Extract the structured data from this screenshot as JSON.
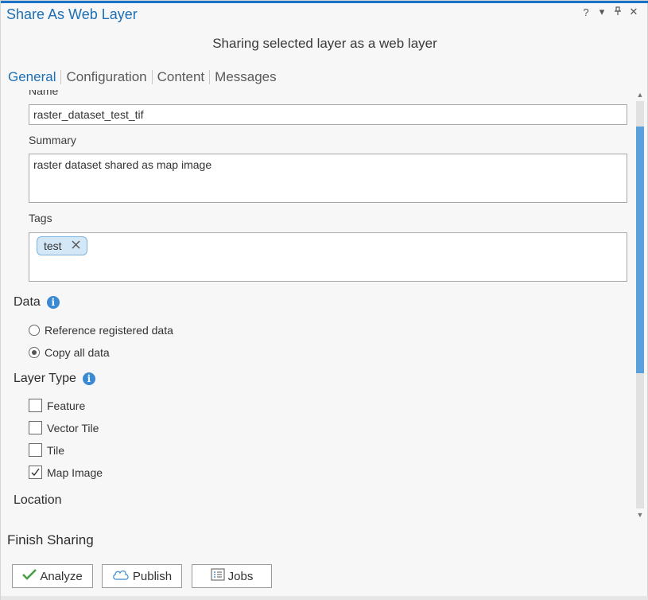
{
  "window": {
    "title": "Share As Web Layer",
    "controls": {
      "help": "?",
      "menu": "▾",
      "pin": "📌",
      "close": "✕"
    }
  },
  "subtitle": "Sharing selected layer as a web layer",
  "tabs": [
    {
      "label": "General",
      "active": true
    },
    {
      "label": "Configuration",
      "active": false
    },
    {
      "label": "Content",
      "active": false
    },
    {
      "label": "Messages",
      "active": false
    }
  ],
  "general": {
    "name_label": "Name",
    "name_value": "raster_dataset_test_tif",
    "summary_label": "Summary",
    "summary_value": "raster dataset shared as map image",
    "tags_label": "Tags",
    "tags": [
      "test"
    ]
  },
  "data_section": {
    "title": "Data",
    "options": [
      {
        "label": "Reference registered data",
        "checked": false
      },
      {
        "label": "Copy all data",
        "checked": true
      }
    ]
  },
  "layer_type": {
    "title": "Layer Type",
    "options": [
      {
        "label": "Feature",
        "checked": false
      },
      {
        "label": "Vector Tile",
        "checked": false
      },
      {
        "label": "Tile",
        "checked": false
      },
      {
        "label": "Map Image",
        "checked": true
      }
    ]
  },
  "location": {
    "title": "Location"
  },
  "finish": {
    "title": "Finish Sharing",
    "analyze_label": "Analyze",
    "publish_label": "Publish",
    "jobs_label": "Jobs"
  },
  "colors": {
    "accent": "#1d6fb5",
    "tag_bg": "#d3e7f7",
    "scroll_thumb": "#5aa0dd",
    "analyze_check": "#4a9e46"
  }
}
